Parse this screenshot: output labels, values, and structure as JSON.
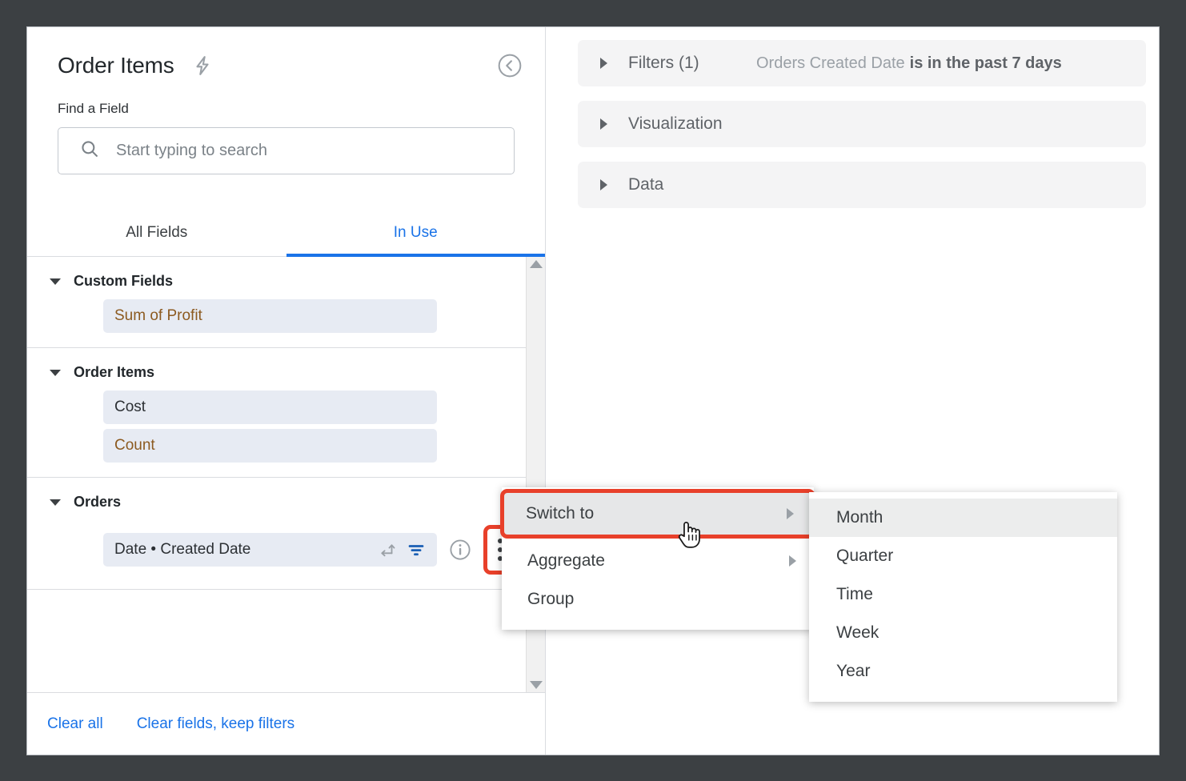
{
  "window": {
    "background_color": "#3c4043",
    "card_border_color": "#b6babf"
  },
  "theme": {
    "accent_blue": "#1a73e8",
    "highlight_red": "#e8402a",
    "measure_brown": "#8c5a20",
    "pill_background": "#e7ebf3",
    "panel_gray": "#f4f4f5"
  },
  "field_panel": {
    "title": "Order Items",
    "bolt_icon": "lightning-bolt-icon",
    "collapse_icon": "circle-chevron-left-icon",
    "find_label": "Find a Field",
    "search": {
      "placeholder": "Start typing to search",
      "value": "",
      "icon": "search-icon"
    },
    "tabs": [
      {
        "label": "All Fields",
        "active": false
      },
      {
        "label": "In Use",
        "active": true
      }
    ],
    "groups": [
      {
        "name": "Custom Fields",
        "expanded": true,
        "fields": [
          {
            "label": "Sum of Profit",
            "type": "measure"
          }
        ]
      },
      {
        "name": "Order Items",
        "expanded": true,
        "fields": [
          {
            "label": "Cost",
            "type": "dimension"
          },
          {
            "label": "Count",
            "type": "measure"
          }
        ]
      },
      {
        "name": "Orders",
        "expanded": true,
        "fields": [
          {
            "label": "Date • Created Date",
            "type": "dimension",
            "icons": [
              "pivot-icon",
              "filter-icon",
              "info-icon",
              "kebab-menu-icon"
            ]
          }
        ]
      }
    ],
    "footer_links": [
      {
        "label": "Clear all"
      },
      {
        "label": "Clear fields, keep filters"
      }
    ],
    "scrollbar": {
      "up_arrow": "scroll-up-arrow-icon",
      "down_arrow": "scroll-down-arrow-icon"
    }
  },
  "right_panel": {
    "sections": [
      {
        "label": "Filters (1)",
        "detail_dim": "Orders Created Date",
        "detail_strong": "is in the past 7 days",
        "expanded": false
      },
      {
        "label": "Visualization",
        "detail_dim": "",
        "detail_strong": "",
        "expanded": false
      },
      {
        "label": "Data",
        "detail_dim": "",
        "detail_strong": "",
        "expanded": false
      }
    ]
  },
  "context_menu": {
    "highlighted_item": "Switch to",
    "items": [
      {
        "label": "Switch to",
        "has_submenu": true,
        "highlighted": true
      },
      {
        "label": "Aggregate",
        "has_submenu": true,
        "highlighted": false
      },
      {
        "label": "Group",
        "has_submenu": false,
        "highlighted": false
      }
    ]
  },
  "submenu": {
    "items": [
      {
        "label": "Month",
        "hovered": true
      },
      {
        "label": "Quarter",
        "hovered": false
      },
      {
        "label": "Time",
        "hovered": false
      },
      {
        "label": "Week",
        "hovered": false
      },
      {
        "label": "Year",
        "hovered": false
      }
    ]
  },
  "cursor": {
    "type": "pointing-hand-cursor"
  }
}
